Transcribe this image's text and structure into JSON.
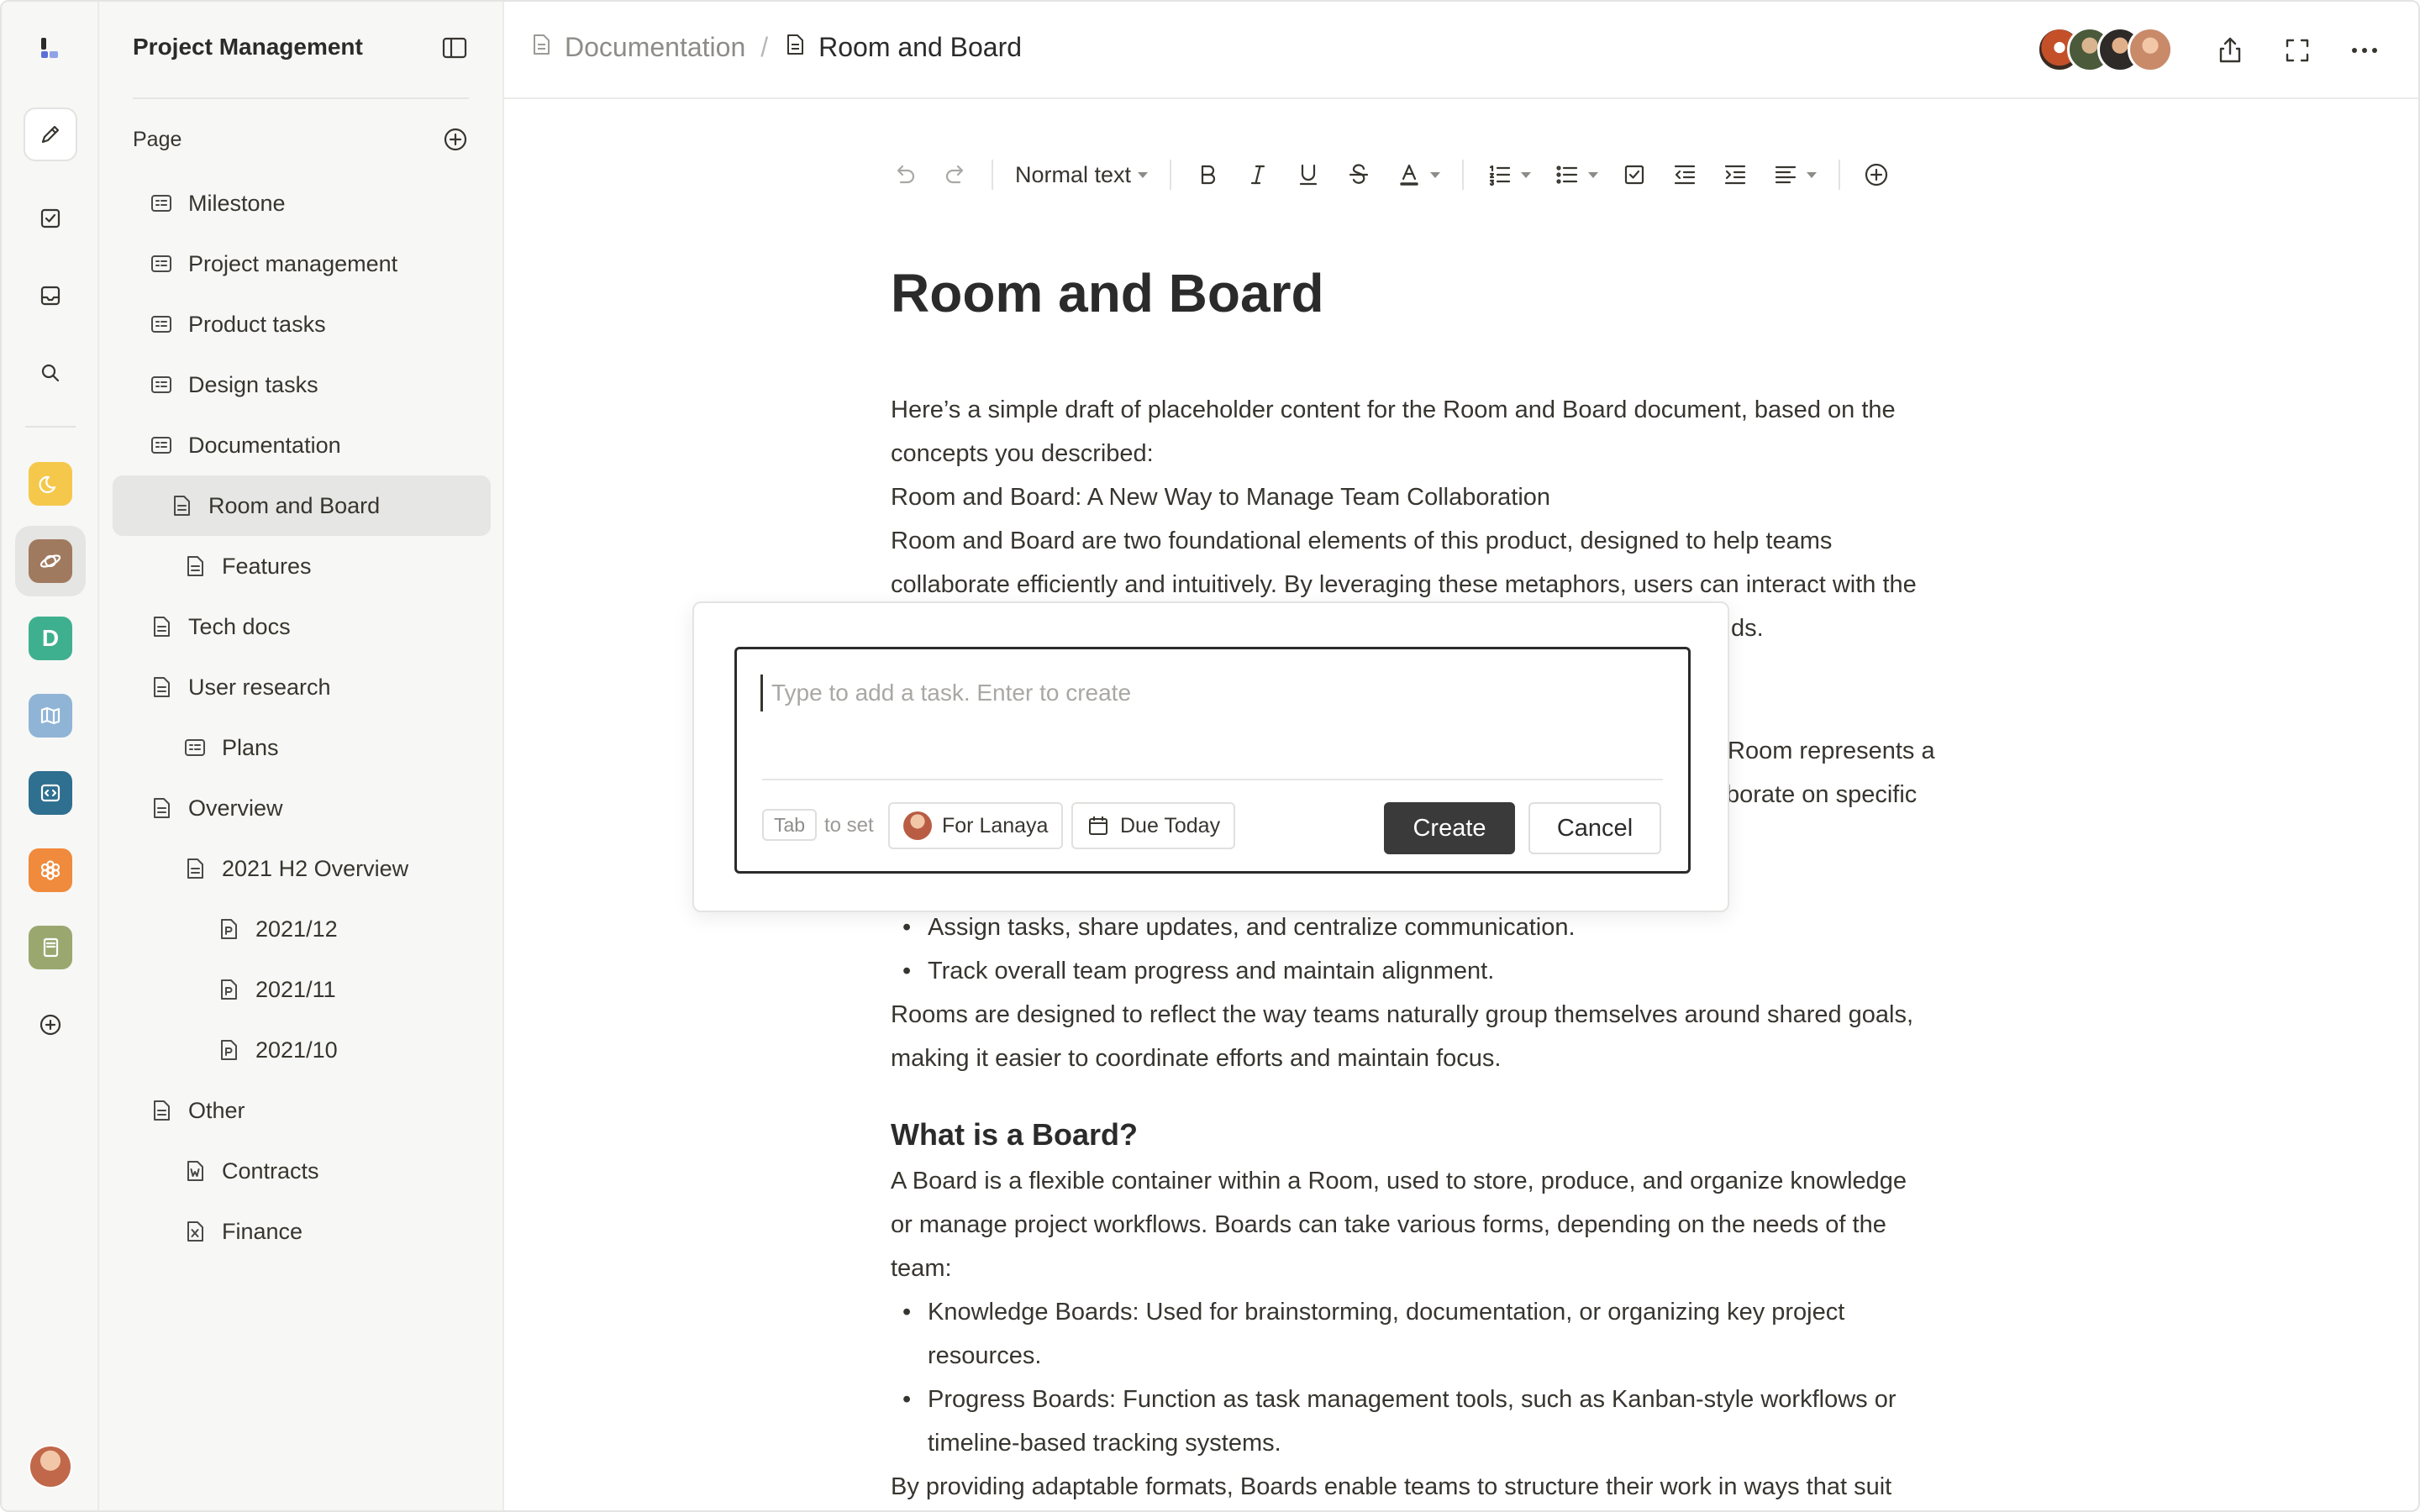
{
  "sidebar": {
    "title": "Project Management",
    "section_label": "Page",
    "items": [
      {
        "label": "Milestone",
        "icon": "board-icon"
      },
      {
        "label": "Project management",
        "icon": "board-icon"
      },
      {
        "label": "Product tasks",
        "icon": "board-icon"
      },
      {
        "label": "Design tasks",
        "icon": "board-icon"
      },
      {
        "label": "Documentation",
        "icon": "board-icon"
      },
      {
        "label": "Room and Board",
        "icon": "doc-icon",
        "active": true
      },
      {
        "label": "Features",
        "icon": "doc-icon"
      },
      {
        "label": "Tech docs",
        "icon": "doc-icon"
      },
      {
        "label": "User research",
        "icon": "doc-icon"
      },
      {
        "label": "Plans",
        "icon": "board-icon"
      },
      {
        "label": "Overview",
        "icon": "doc-icon"
      },
      {
        "label": "2021 H2 Overview",
        "icon": "doc-icon"
      },
      {
        "label": "2021/12",
        "icon": "p-file-icon"
      },
      {
        "label": "2021/11",
        "icon": "p-file-icon"
      },
      {
        "label": "2021/10",
        "icon": "p-file-icon"
      },
      {
        "label": "Other",
        "icon": "doc-icon"
      },
      {
        "label": "Contracts",
        "icon": "w-file-icon"
      },
      {
        "label": "Finance",
        "icon": "x-file-icon"
      }
    ]
  },
  "rail": {
    "apps": [
      {
        "name": "moon-app-icon",
        "color": "#f5c84c"
      },
      {
        "name": "planet-app-icon",
        "color": "#a07a5f"
      },
      {
        "name": "d-app-icon",
        "color": "#3fb08f",
        "letter": "D"
      },
      {
        "name": "map-app-icon",
        "color": "#8fb4d6"
      },
      {
        "name": "code-app-icon",
        "color": "#2f6f8f"
      },
      {
        "name": "flower-app-icon",
        "color": "#f08a3c"
      },
      {
        "name": "book-app-icon",
        "color": "#9aa870"
      }
    ]
  },
  "header": {
    "breadcrumb_parent": "Documentation",
    "breadcrumb_separator": "/",
    "breadcrumb_current": "Room and Board"
  },
  "toolbar": {
    "text_style": "Normal text"
  },
  "document": {
    "title": "Room and Board",
    "lines": [
      "Here’s a simple draft of placeholder content for the Room and Board document, based on the",
      "concepts you described:",
      "Room and Board: A New Way to Manage Team Collaboration",
      "Room and Board are two foundational elements of this product, designed to help teams",
      "collaborate efficiently and intuitively. By leveraging these metaphors, users can interact with the",
      "ds.",
      "Room represents a",
      "borate on specific"
    ],
    "bullets_a": [
      "Assign tasks, share updates, and centralize communication.",
      "Track overall team progress and maintain alignment."
    ],
    "rooms_para": [
      "Rooms are designed to reflect the way teams naturally group themselves around shared goals,",
      "making it easier to coordinate efforts and maintain focus."
    ],
    "board_heading": "What is a Board?",
    "board_para": [
      "A Board is a flexible container within a Room, used to store, produce, and organize knowledge",
      "or manage project workflows. Boards can take various forms, depending on the needs of the",
      "team:"
    ],
    "bullets_b": [
      "Knowledge Boards: Used for brainstorming, documentation, or organizing key project",
      "resources.",
      "Progress Boards: Function as task management tools, such as Kanban-style workflows or",
      "timeline-based tracking systems."
    ],
    "last_line": "By providing adaptable formats, Boards enable teams to structure their work in ways that suit"
  },
  "task_dialog": {
    "placeholder": "Type to add a task. Enter to create",
    "tab_key": "Tab",
    "tab_hint": "to set",
    "assignee_chip": "For Lanaya",
    "due_chip": "Due Today",
    "create_label": "Create",
    "cancel_label": "Cancel"
  }
}
